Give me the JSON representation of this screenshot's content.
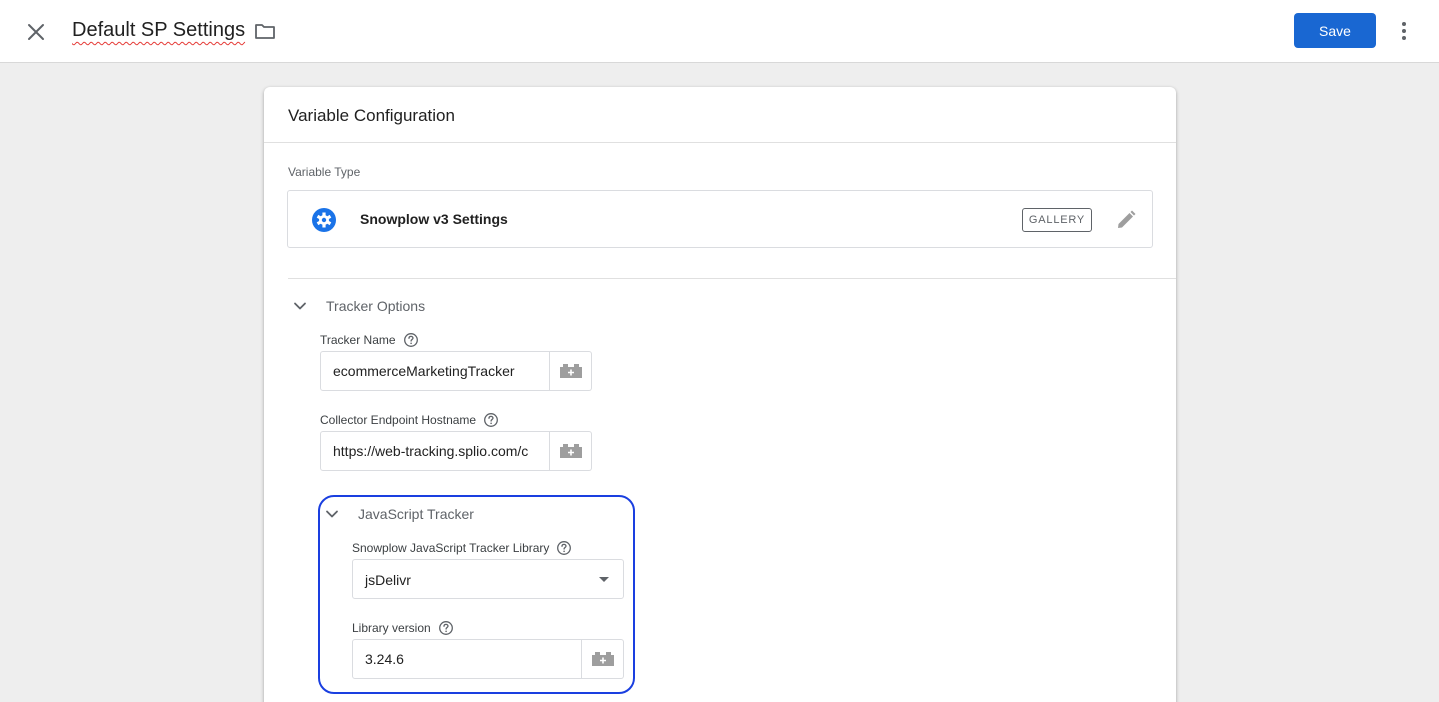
{
  "header": {
    "title": "Default SP Settings",
    "save_label": "Save"
  },
  "card": {
    "title": "Variable Configuration",
    "variable_type_label": "Variable Type",
    "variable_type_name": "Snowplow v3 Settings",
    "gallery_badge": "GALLERY"
  },
  "tracker_options": {
    "section_title": "Tracker Options",
    "tracker_name_label": "Tracker Name",
    "tracker_name_value": "ecommerceMarketingTracker",
    "collector_label": "Collector Endpoint Hostname",
    "collector_value": "https://web-tracking.splio.com/c"
  },
  "js_tracker": {
    "section_title": "JavaScript Tracker",
    "library_label": "Snowplow JavaScript Tracker Library",
    "library_selected": "jsDelivr",
    "version_label": "Library version",
    "version_value": "3.24.6"
  },
  "colors": {
    "accent": "#1967d2",
    "highlight_outline": "#1a3fe0",
    "title_spellcheck_underline": "#e53935"
  },
  "icons": [
    "close-icon",
    "folder-icon",
    "more-vert-icon",
    "settings-gear-icon",
    "pencil-icon",
    "chevron-down-icon",
    "help-circle-icon",
    "lego-brick-icon",
    "dropdown-arrow-icon"
  ]
}
